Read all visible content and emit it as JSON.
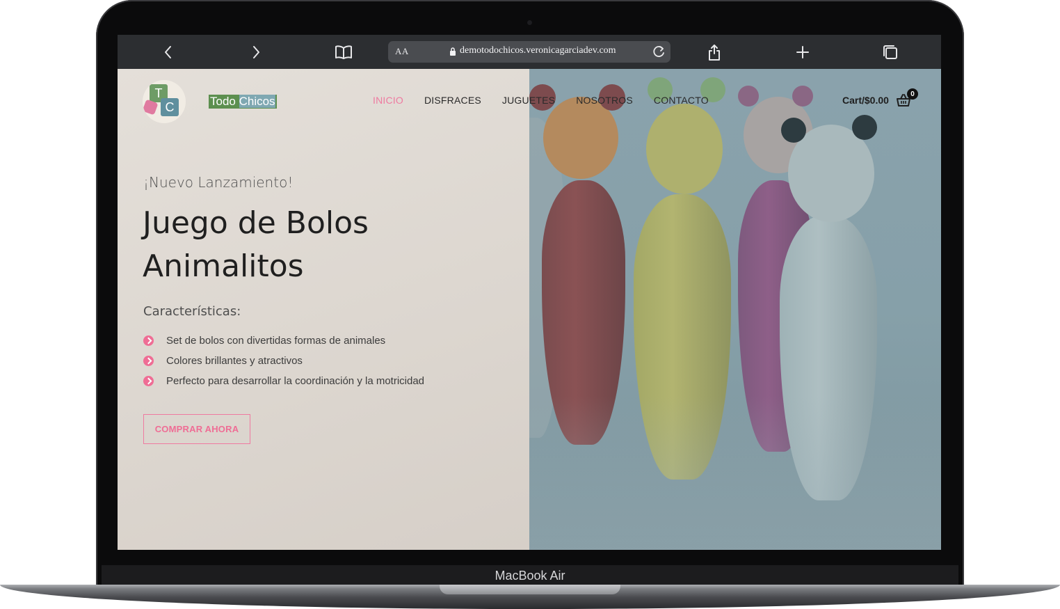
{
  "device": {
    "model_label": "MacBook Air"
  },
  "browser": {
    "aa_label": "AA",
    "url": "demotodochicos.veronicagarciadev.com",
    "icons": [
      "chevron-left-icon",
      "chevron-right-icon",
      "book-icon",
      "lock-icon",
      "reload-icon",
      "share-icon",
      "plus-icon",
      "tabs-icon"
    ]
  },
  "header": {
    "logo_letters": [
      "T",
      "C"
    ],
    "brand_part1": "Todo ",
    "brand_part2": "Chicos",
    "nav": [
      {
        "label": "INICIO",
        "active": true
      },
      {
        "label": "DISFRACES",
        "active": false
      },
      {
        "label": "JUGUETES",
        "active": false
      },
      {
        "label": "NOSOTROS",
        "active": false
      },
      {
        "label": "CONTACTO",
        "active": false
      }
    ],
    "cart_label": "Cart/$0.00",
    "cart_count": "0"
  },
  "hero": {
    "eyebrow": "¡Nuevo Lanzamiento!",
    "title": "Juego de Bolos Animalitos",
    "features_title": "Características:",
    "features": [
      "Set de bolos con divertidas formas de animales",
      "Colores brillantes y atractivos",
      "Perfecto para desarrollar la coordinación y la motricidad"
    ],
    "cta": "COMPRAR AHORA"
  },
  "colors": {
    "accent": "#ef6d95",
    "brand_green": "#5c8f4f",
    "overlay_teal": "#86a0a9"
  }
}
